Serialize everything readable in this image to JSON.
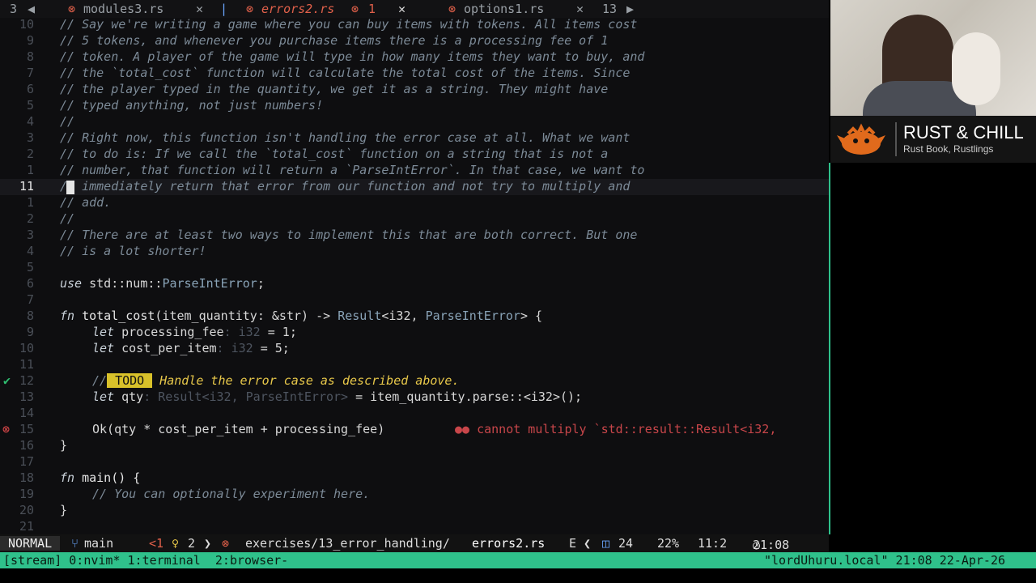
{
  "tabs": {
    "left_count": "3",
    "items": [
      {
        "label": "modules3.rs",
        "close": "✕"
      },
      {
        "label": "errors2.rs",
        "badge": "1",
        "close": "✕"
      },
      {
        "label": "options1.rs",
        "close": "✕"
      }
    ],
    "right_count": "13"
  },
  "editor": {
    "lines": [
      {
        "num": "10",
        "text": "// Say we're writing a game where you can buy items with tokens. All items cost"
      },
      {
        "num": "9",
        "text": "// 5 tokens, and whenever you purchase items there is a processing fee of 1"
      },
      {
        "num": "8",
        "text": "// token. A player of the game will type in how many items they want to buy, and"
      },
      {
        "num": "7",
        "text": "// the `total_cost` function will calculate the total cost of the items. Since"
      },
      {
        "num": "6",
        "text": "// the player typed in the quantity, we get it as a string. They might have"
      },
      {
        "num": "5",
        "text": "// typed anything, not just numbers!"
      },
      {
        "num": "4",
        "text": "//"
      },
      {
        "num": "3",
        "text": "// Right now, this function isn't handling the error case at all. What we want"
      },
      {
        "num": "2",
        "text": "// to do is: If we call the `total_cost` function on a string that is not a"
      },
      {
        "num": "1",
        "text": "// number, that function will return a `ParseIntError`. In that case, we want to"
      },
      {
        "num": "11",
        "text": "// immediately return that error from our function and not try to multiply and"
      },
      {
        "num": "1",
        "text": "// add."
      },
      {
        "num": "2",
        "text": "//"
      },
      {
        "num": "3",
        "text": "// There are at least two ways to implement this that are both correct. But one"
      },
      {
        "num": "4",
        "text": "// is a lot shorter!"
      },
      {
        "num": "5",
        "text": ""
      },
      {
        "num": "6",
        "text": ""
      },
      {
        "num": "7",
        "text": ""
      },
      {
        "num": "8",
        "text": ""
      },
      {
        "num": "9",
        "text": ""
      },
      {
        "num": "10",
        "text": ""
      },
      {
        "num": "11",
        "text": ""
      },
      {
        "num": "12",
        "text": ""
      },
      {
        "num": "13",
        "text": ""
      },
      {
        "num": "14",
        "text": ""
      },
      {
        "num": "15",
        "text": ""
      },
      {
        "num": "16",
        "text": ""
      },
      {
        "num": "17",
        "text": ""
      },
      {
        "num": "18",
        "text": ""
      },
      {
        "num": "19",
        "text": ""
      },
      {
        "num": "20",
        "text": ""
      },
      {
        "num": "21",
        "text": ""
      }
    ],
    "code": {
      "use_kw": "use",
      "use_path": " std::num::",
      "use_type": "ParseIntError",
      "use_end": ";",
      "fn_kw": "fn",
      "fn_name": " total_cost",
      "fn_params": "(item_quantity: &str) -> ",
      "ret1": "Result",
      "ret_gen": "<i32, ",
      "ret2": "ParseIntError",
      "ret_end": "> {",
      "let_kw": "let",
      "pf_name": " processing_fee",
      "pf_hint": ": i32",
      "pf_val": " = 1;",
      "cpi_name": " cost_per_item",
      "cpi_hint": ": i32",
      "cpi_val": " = 5;",
      "todo_prefix": "//",
      "todo_badge": "TODO",
      "todo_text": " Handle the error case as described above.",
      "qty_name": " qty",
      "qty_hint": ": Result<i32, ParseIntError>",
      "qty_val": " = item_quantity.parse::<i32>();",
      "ok_line": "Ok(qty * cost_per_item + processing_fee)",
      "close_brace": "}",
      "main_kw": "fn",
      "main_rest": " main() {",
      "main_comment": "// You can optionally experiment here.",
      "main_close": "}"
    },
    "diagnostic": "●● cannot multiply `std::result::Result<i32,"
  },
  "statusline": {
    "mode": "NORMAL",
    "branch": "main",
    "diff": "<1",
    "hints": "2",
    "path": "exercises/13_error_handling/",
    "file": "errors2.rs",
    "enc": "E",
    "lines_count": "24",
    "percent": "22%",
    "position": "11:2",
    "time": "21:08"
  },
  "tmux": {
    "left": "[stream] 0:nvim* 1:terminal  2:browser-",
    "right": "\"lordUhuru.local\" 21:08 22-Apr-26"
  },
  "brand": {
    "title": "RUST & CHILL",
    "subtitle": "Rust Book, Rustlings"
  },
  "colors": {
    "accent": "#2fc18b",
    "error": "#e0484a",
    "todo": "#d8c12a"
  }
}
